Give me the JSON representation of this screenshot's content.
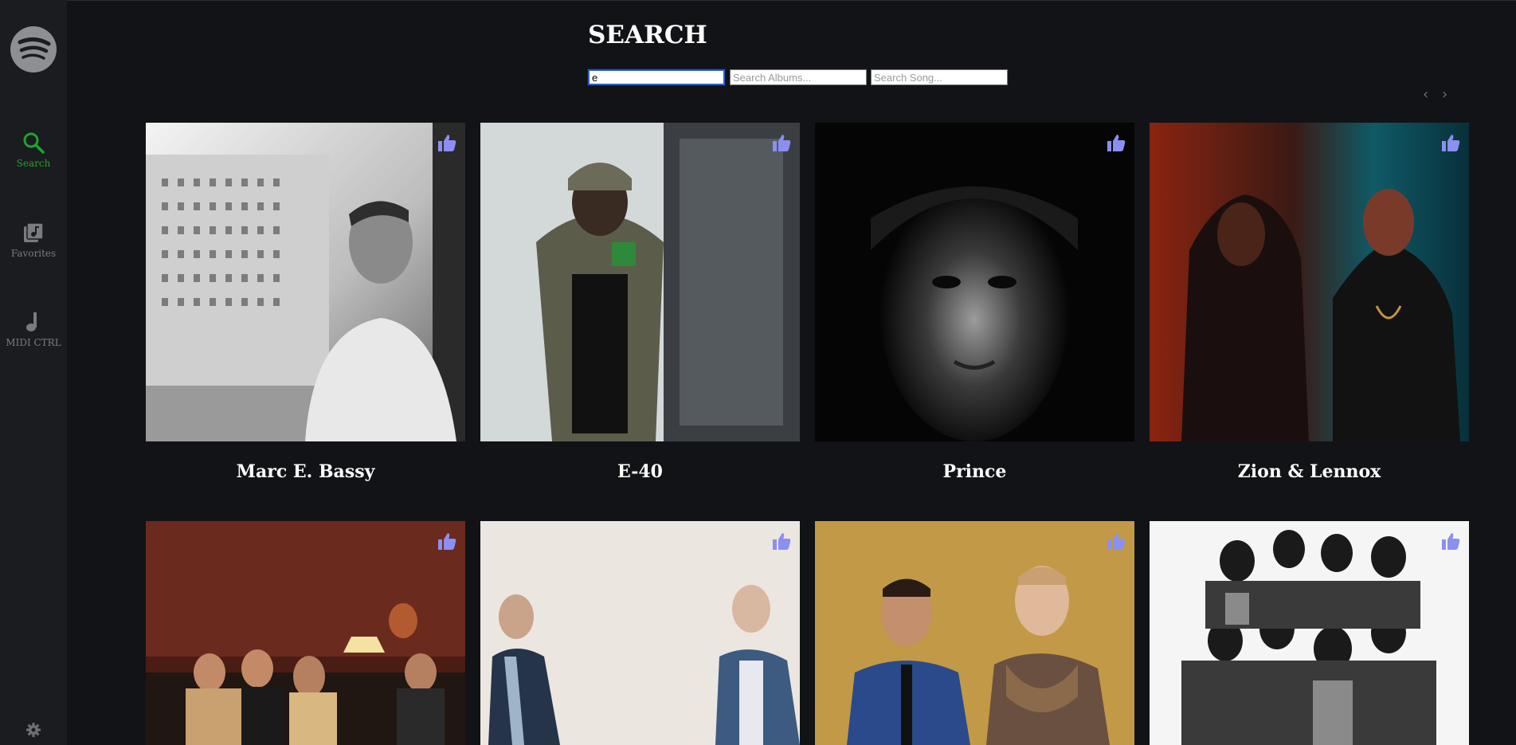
{
  "page": {
    "title": "SEARCH",
    "accent_color": "#1ba52c",
    "like_color": "#8b8ff0"
  },
  "sidebar": {
    "logo": "spotify-logo",
    "items": [
      {
        "label": "Search",
        "icon": "search-icon",
        "active": true
      },
      {
        "label": "Favorites",
        "icon": "music-library-icon",
        "active": false
      },
      {
        "label": "MIDI CTRL",
        "icon": "music-note-icon",
        "active": false
      }
    ],
    "settings_icon": "gear-icon"
  },
  "search": {
    "artist_value": "e",
    "album_placeholder": "Search Albums...",
    "song_placeholder": "Search Song..."
  },
  "pager": {
    "prev": "‹",
    "next": "›"
  },
  "artists": [
    {
      "name": "Marc E. Bassy",
      "icon": "thumbs-up-icon"
    },
    {
      "name": "E-40",
      "icon": "thumbs-up-icon"
    },
    {
      "name": "Prince",
      "icon": "thumbs-up-icon"
    },
    {
      "name": "Zion & Lennox",
      "icon": "thumbs-up-icon"
    },
    {
      "name": "",
      "icon": "thumbs-up-icon"
    },
    {
      "name": "",
      "icon": "thumbs-up-icon"
    },
    {
      "name": "",
      "icon": "thumbs-up-icon"
    },
    {
      "name": "",
      "icon": "thumbs-up-icon"
    }
  ]
}
